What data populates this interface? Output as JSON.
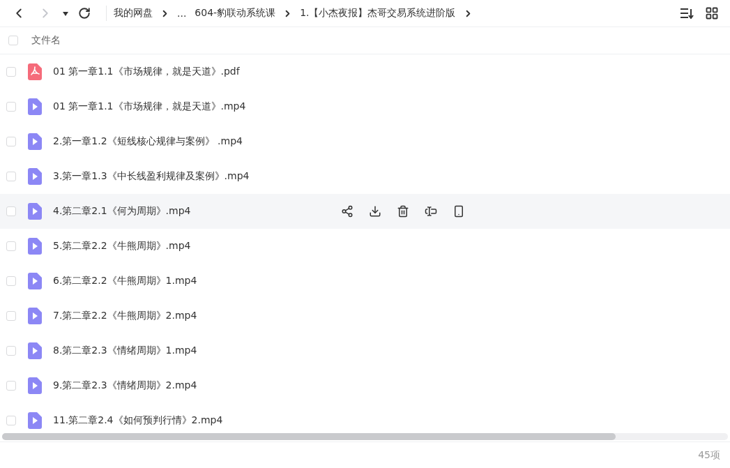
{
  "breadcrumb": [
    {
      "label": "我的网盘"
    },
    {
      "label": "..."
    },
    {
      "label": "604-豹联动系统课"
    },
    {
      "label": "1.【小杰夜报】杰哥交易系统进阶版"
    }
  ],
  "header": {
    "checked": false,
    "column": "文件名"
  },
  "files": [
    {
      "name": "01 第一章1.1《市场规律，就是天道》.pdf",
      "kind": "pdf",
      "checked": false,
      "hovered": false
    },
    {
      "name": "01 第一章1.1《市场规律，就是天道》.mp4",
      "kind": "video",
      "checked": false,
      "hovered": false
    },
    {
      "name": "2.第一章1.2《短线核心规律与案例》 .mp4",
      "kind": "video",
      "checked": false,
      "hovered": false
    },
    {
      "name": "3.第一章1.3《中长线盈利规律及案例》.mp4",
      "kind": "video",
      "checked": false,
      "hovered": false
    },
    {
      "name": "4.第二章2.1《何为周期》.mp4",
      "kind": "video",
      "checked": false,
      "hovered": true
    },
    {
      "name": "5.第二章2.2《牛熊周期》.mp4",
      "kind": "video",
      "checked": false,
      "hovered": false
    },
    {
      "name": "6.第二章2.2《牛熊周期》1.mp4",
      "kind": "video",
      "checked": false,
      "hovered": false
    },
    {
      "name": "7.第二章2.2《牛熊周期》2.mp4",
      "kind": "video",
      "checked": false,
      "hovered": false
    },
    {
      "name": "8.第二章2.3《情绪周期》1.mp4",
      "kind": "video",
      "checked": false,
      "hovered": false
    },
    {
      "name": "9.第二章2.3《情绪周期》2.mp4",
      "kind": "video",
      "checked": false,
      "hovered": false
    },
    {
      "name": "11.第二章2.4《如何预判行情》2.mp4",
      "kind": "video",
      "checked": false,
      "hovered": false
    }
  ],
  "count": "45项"
}
